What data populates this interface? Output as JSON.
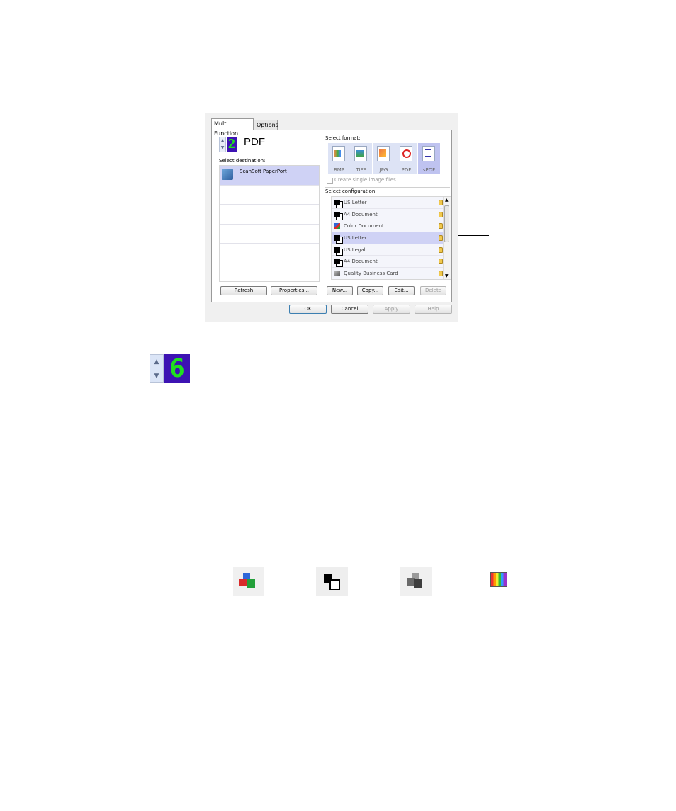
{
  "dialog": {
    "tabs": [
      {
        "label": "Multi Function",
        "active": true
      },
      {
        "label": "Options",
        "active": false
      }
    ],
    "destination_count": "2",
    "selected_format_name": "PDF",
    "select_destination_label": "Select destination:",
    "destinations": [
      {
        "label": "ScanSoft PaperPort",
        "selected": true
      }
    ],
    "select_format_label": "Select format:",
    "formats": [
      {
        "label": "BMP",
        "selected": false
      },
      {
        "label": "TIFF",
        "selected": false
      },
      {
        "label": "JPG",
        "selected": false
      },
      {
        "label": "PDF",
        "selected": false
      },
      {
        "label": "sPDF",
        "selected": true
      }
    ],
    "create_single_image_label": "Create single image files",
    "select_configuration_label": "Select configuration:",
    "configurations": [
      {
        "label": "US Letter",
        "icon": "bw-icon",
        "selected": false
      },
      {
        "label": "A4 Document",
        "icon": "bw-icon",
        "selected": false
      },
      {
        "label": "Color Document",
        "icon": "color-icon",
        "selected": false
      },
      {
        "label": "US Letter",
        "icon": "bw-icon",
        "selected": true
      },
      {
        "label": "US Legal",
        "icon": "bw-icon",
        "selected": false
      },
      {
        "label": "A4 Document",
        "icon": "bw-icon",
        "selected": false
      },
      {
        "label": "Quality Business Card",
        "icon": "grayscale-icon",
        "selected": false
      }
    ],
    "buttons": {
      "refresh": "Refresh",
      "properties": "Properties...",
      "new": "New...",
      "copy": "Copy...",
      "edit": "Edit...",
      "delete": "Delete",
      "ok": "OK",
      "cancel": "Cancel",
      "apply": "Apply",
      "help": "Help"
    }
  },
  "large_counter": {
    "digit": "6"
  },
  "colors": {
    "digit_bg": "#3d13b3",
    "digit_fg": "#20e020",
    "selection": "#cfd2f5"
  }
}
